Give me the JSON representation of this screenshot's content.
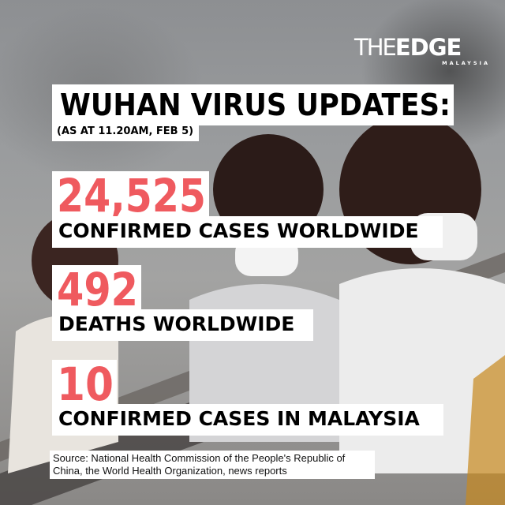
{
  "brand": {
    "logo_main_the": "THE",
    "logo_main_edge": "EDGE",
    "logo_sub": "MALAYSIA"
  },
  "headline": {
    "title": "WUHAN VIRUS UPDATES:",
    "subtitle": "(AS AT 11.20AM, FEB 5)"
  },
  "stats": [
    {
      "value": "24,525",
      "label": "CONFIRMED CASES WORLDWIDE"
    },
    {
      "value": "492",
      "label": "DEATHS WORLDWIDE"
    },
    {
      "value": "10",
      "label": "CONFIRMED CASES IN MALAYSIA"
    }
  ],
  "source": "Source: National Health Commission of the People's Republic of China, the World Health Organization, news reports",
  "colors": {
    "accent": "#ef5a5f",
    "text": "#000000",
    "banner_bg": "#ffffff"
  },
  "background_image": "escalator-commuters-wearing-face-masks-photo"
}
